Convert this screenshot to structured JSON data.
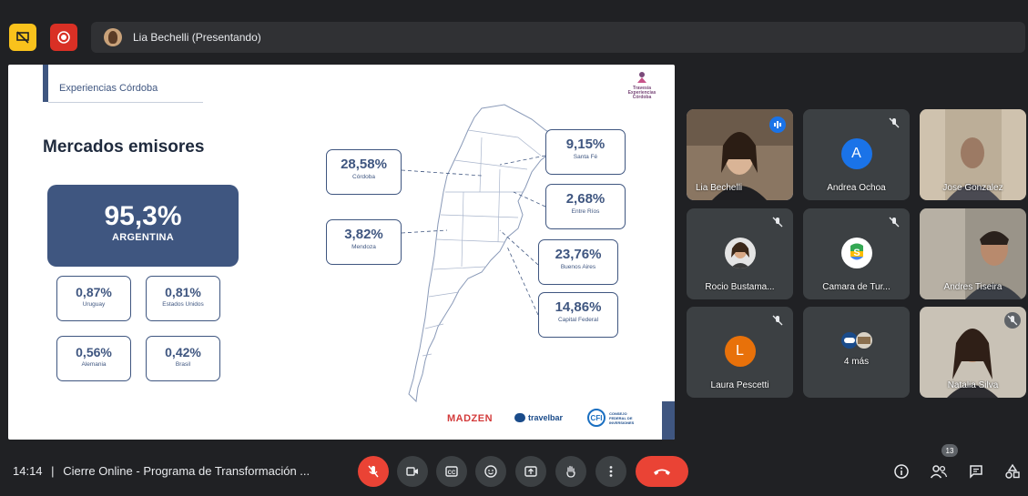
{
  "presenter": {
    "name": "Lia Bechelli (Presentando)"
  },
  "slide": {
    "header": "Experiencias Córdoba",
    "logo_text_1": "Travesía",
    "logo_text_2": "Experiencias",
    "logo_text_3": "Córdoba",
    "title": "Mercados emisores",
    "main": {
      "pct": "95,3%",
      "label": "ARGENTINA"
    },
    "stats": [
      {
        "pct": "0,87%",
        "label": "Uruguay"
      },
      {
        "pct": "0,81%",
        "label": "Estados Unidos"
      },
      {
        "pct": "0,56%",
        "label": "Alemania"
      },
      {
        "pct": "0,42%",
        "label": "Brasil"
      }
    ],
    "map_stats": [
      {
        "pct": "28,58%",
        "label": "Córdoba"
      },
      {
        "pct": "3,82%",
        "label": "Mendoza"
      },
      {
        "pct": "9,15%",
        "label": "Santa Fé"
      },
      {
        "pct": "2,68%",
        "label": "Entre Ríos"
      },
      {
        "pct": "23,76%",
        "label": "Buenos Aires"
      },
      {
        "pct": "14,86%",
        "label": "Capital Federal"
      }
    ],
    "sponsors": {
      "madzen": "MADZEN",
      "travelbar": "travelbar",
      "cfi": "CFI",
      "cfi_text": "CONSEJO FEDERAL DE INVERSIONES"
    }
  },
  "participants": [
    {
      "name": "Lia Bechelli"
    },
    {
      "name": "Andrea Ochoa",
      "initial": "A",
      "color": "#1a73e8"
    },
    {
      "name": "Jose Gonzalez"
    },
    {
      "name": "Rocio Bustama..."
    },
    {
      "name": "Camara de Tur..."
    },
    {
      "name": "Andres Tiseira"
    },
    {
      "name": "Laura Pescetti",
      "initial": "L",
      "color": "#e8710a"
    },
    {
      "name": "4 más"
    },
    {
      "name": "Natalia Silva"
    }
  ],
  "bottom": {
    "time": "14:14",
    "separator": "|",
    "meeting_title": "Cierre Online - Programa de Transformación ...",
    "participant_count": "13"
  },
  "colors": {
    "accent": "#3f5680",
    "end_call": "#ea4335"
  }
}
